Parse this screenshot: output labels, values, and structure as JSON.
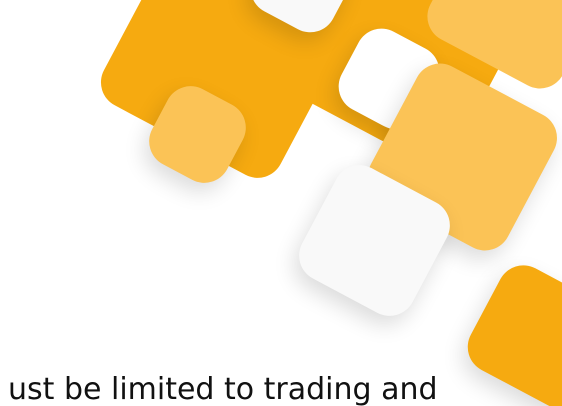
{
  "decoration": {
    "icon": "rounded-square-tile-pattern",
    "colors": {
      "primary": "#F6AA10",
      "secondary": "#FBC356",
      "light": "#F9F9F9"
    }
  },
  "caption": {
    "text": "ust be limited to trading and"
  }
}
